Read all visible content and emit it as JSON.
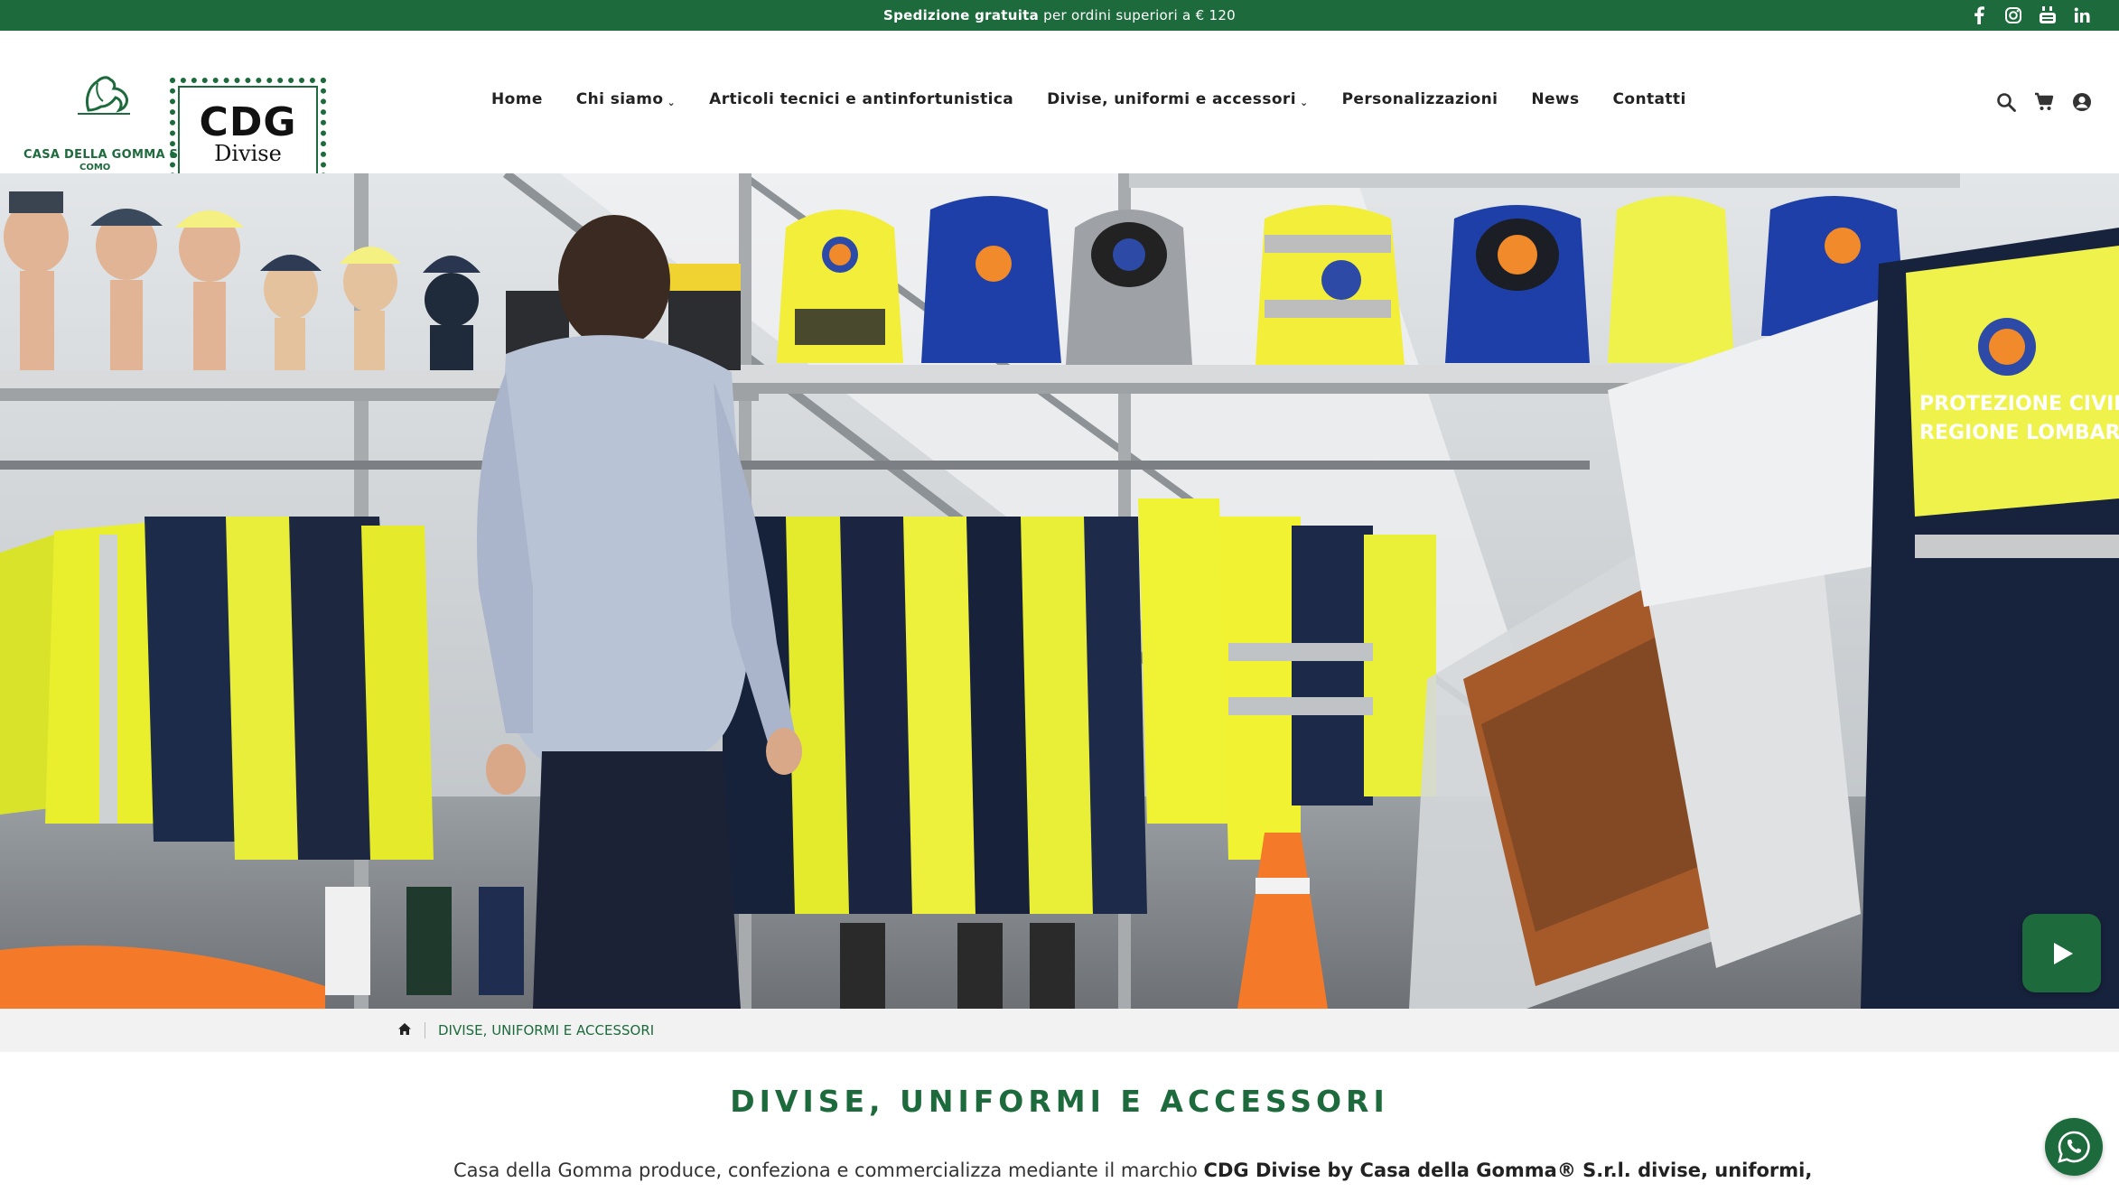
{
  "topbar": {
    "promo_bold": "Spedizione gratuita",
    "promo_rest": "per ordini superiori a € 120",
    "social": [
      "facebook-icon",
      "instagram-icon",
      "youtube-icon",
      "linkedin-icon"
    ]
  },
  "header": {
    "logo_left_text": "CASA DELLA GOMMA S.R.L.",
    "logo_left_city": "COMO",
    "logo_cdg_big": "CDG",
    "logo_cdg_small": "Divise",
    "nav": [
      {
        "label": "Home",
        "has_dropdown": false
      },
      {
        "label": "Chi siamo",
        "has_dropdown": true
      },
      {
        "label": "Articoli tecnici e antinfortunistica",
        "has_dropdown": false
      },
      {
        "label": "Divise, uniformi e accessori",
        "has_dropdown": true
      },
      {
        "label": "Personalizzazioni",
        "has_dropdown": false
      },
      {
        "label": "News",
        "has_dropdown": false
      },
      {
        "label": "Contatti",
        "has_dropdown": false
      }
    ],
    "icons": [
      "search-icon",
      "cart-icon",
      "account-icon"
    ]
  },
  "hero": {
    "sign_line1": "PROTEZIONE CIVILE",
    "sign_line2": "REGIONE LOMBARDIA",
    "play_icon": "play-icon"
  },
  "breadcrumb": {
    "home_icon": "home-icon",
    "current": "DIVISE, UNIFORMI E ACCESSORI"
  },
  "main": {
    "title": "DIVISE, UNIFORMI E ACCESSORI",
    "intro_start": "Casa della Gomma produce, confeziona e commercializza mediante il marchio ",
    "intro_bold": "CDG Divise by Casa della Gomma® S.r.l. divise, uniformi,"
  },
  "colors": {
    "brand_green": "#1d6b3c",
    "breadcrumb_bg": "#f2f2f2"
  }
}
